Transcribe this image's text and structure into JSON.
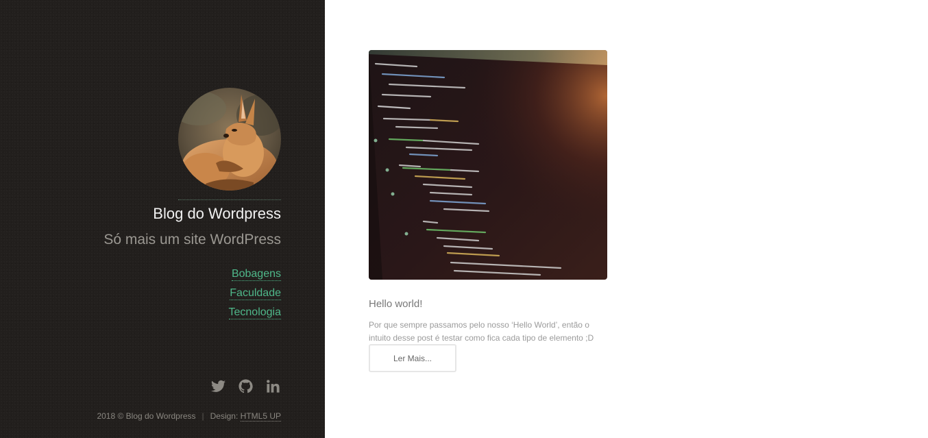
{
  "sidebar": {
    "site_title": "Blog do Wordpress",
    "tagline": "Só mais um site WordPress",
    "nav": [
      {
        "label": "Bobagens"
      },
      {
        "label": "Faculdade"
      },
      {
        "label": "Tecnologia"
      }
    ],
    "social": [
      {
        "icon": "twitter-icon"
      },
      {
        "icon": "github-icon"
      },
      {
        "icon": "linkedin-icon"
      }
    ],
    "footer": {
      "copyright": "2018 © Blog do Wordpress",
      "separator": "|",
      "design_label": "Design:",
      "design_link": "HTML5 UP"
    }
  },
  "post": {
    "image_icon": "code-screen-photo",
    "title": "Hello world!",
    "excerpt": "Por que sempre passamos pelo nosso ‘Hello World’, então o intuito desse post é testar como fica cada tipo de elemento ;D",
    "read_more": "Ler Mais..."
  },
  "colors": {
    "sidebar_bg": "#221f1d",
    "accent": "#4fb88a",
    "title": "#f2f2f2",
    "tagline": "#9b9892"
  }
}
